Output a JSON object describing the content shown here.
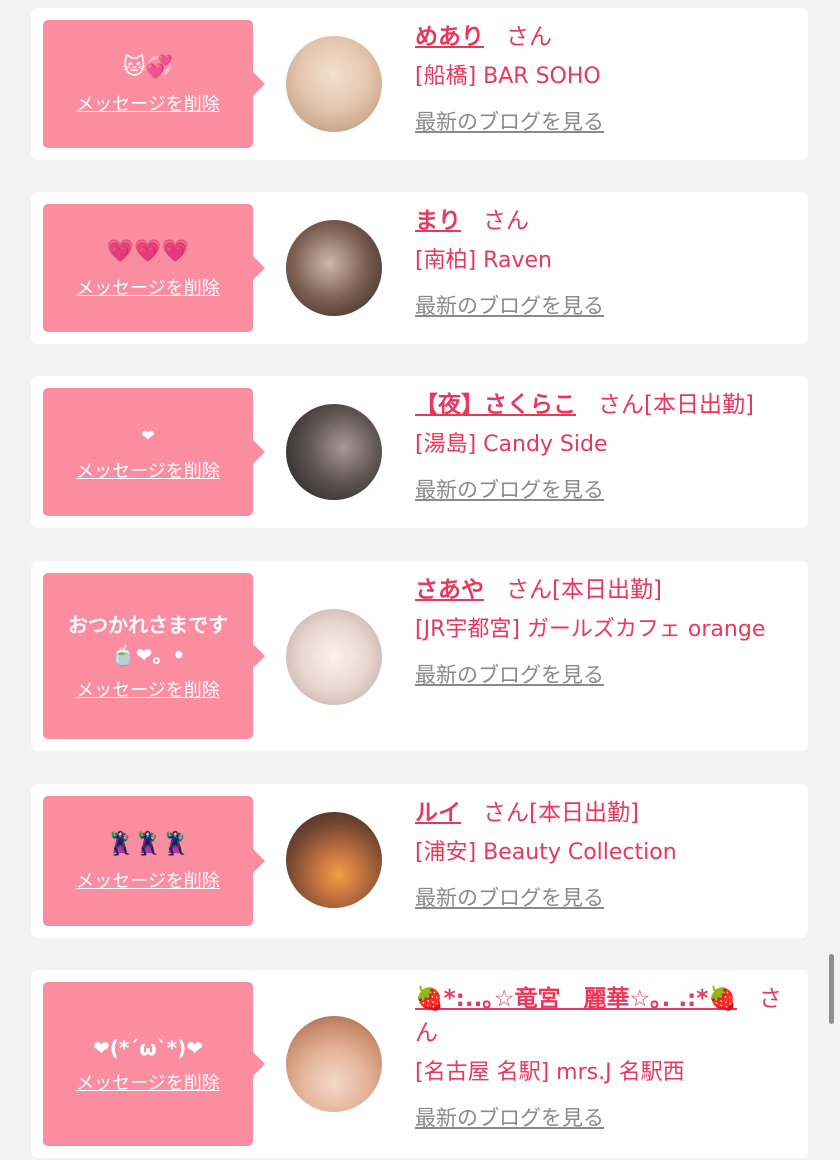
{
  "favorites": [
    {
      "message": "🐱💞",
      "delete_label": "メッセージを削除",
      "name": "めあり",
      "honorific": "さん",
      "status": "",
      "shop": "[船橋] BAR SOHO",
      "blog_label": "最新のブログを見る",
      "avatar_colors": [
        "#d9c0a8",
        "#f2e0d0"
      ]
    },
    {
      "message": "💗💗💗",
      "delete_label": "メッセージを削除",
      "name": "まり",
      "honorific": "さん",
      "status": "",
      "shop": "[南柏] Raven",
      "blog_label": "最新のブログを見る",
      "avatar_colors": [
        "#3a2c26",
        "#cdb8aa"
      ]
    },
    {
      "message": "❤",
      "delete_label": "メッセージを削除",
      "name": "【夜】さくらこ",
      "honorific": "さん",
      "status": "[本日出勤]",
      "shop": "[湯島] Candy Side",
      "blog_label": "最新のブログを見る",
      "avatar_colors": [
        "#2b2a2e",
        "#a59a98"
      ]
    },
    {
      "message": "おつかれさまです\n🍵❤。•",
      "delete_label": "メッセージを削除",
      "name": "さあや",
      "honorific": "さん",
      "status": "[本日出勤]",
      "shop": "[JR宇都宮] ガールズカフェ orange",
      "blog_label": "最新のブログを見る",
      "avatar_colors": [
        "#e8d6cf",
        "#fdf2ee"
      ]
    },
    {
      "message": "🦹‍♀️🦹‍♀️🦹‍♀️",
      "delete_label": "メッセージを削除",
      "name": "ルイ",
      "honorific": "さん",
      "status": "[本日出勤]",
      "shop": "[浦安] Beauty Collection",
      "blog_label": "最新のブログを見る",
      "avatar_colors": [
        "#6d4430",
        "#f0a040"
      ]
    },
    {
      "message": "❤(*´ω`*)❤",
      "delete_label": "メッセージを削除",
      "name": "🍓*:..｡☆竜宮　麗華☆｡. .:*🍓",
      "honorific": "さん",
      "status": "",
      "shop": "[名古屋 名駅] mrs.J 名駅西",
      "blog_label": "最新のブログを見る",
      "avatar_colors": [
        "#c98d6e",
        "#f5d8c8"
      ]
    }
  ]
}
